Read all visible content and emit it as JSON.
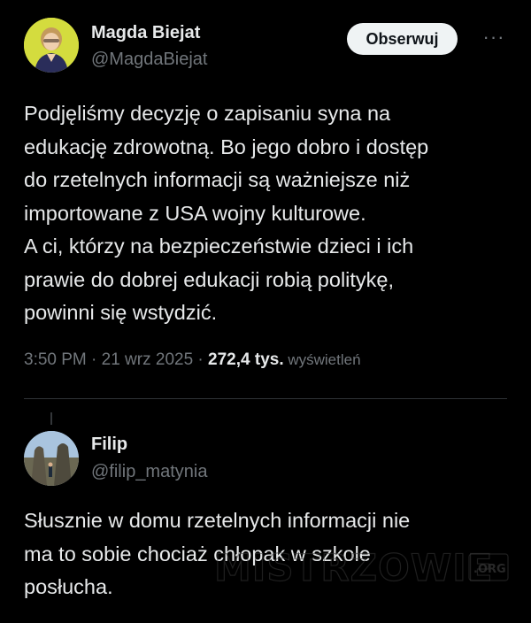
{
  "tweet": {
    "author_name": "Magda Biejat",
    "author_handle": "@MagdaBiejat",
    "follow_label": "Obserwuj",
    "more_label": "···",
    "text": "Podjęliśmy decyzję o zapisaniu syna na\nedukację zdrowotną. Bo jego dobro i dostęp\ndo rzetelnych informacji są ważniejsze niż\nimportowane z USA wojny kulturowe.\nA ci, którzy na bezpieczeństwie dzieci i ich\nprawie do dobrej edukacji robią politykę,\npowinni się wstydzić.",
    "time": "3:50 PM · 21 wrz 2025 · ",
    "views_count": "272,4 tys.",
    "views_label": " wyświetleń"
  },
  "reply": {
    "author_name": "Filip",
    "author_handle": "@filip_matynia",
    "text": "Słusznie w domu rzetelnych informacji nie\nma to sobie chociaż chłopak w szkole\nposłucha."
  },
  "watermark": {
    "text": "MISTRZOWIE",
    "suffix": ".ORG"
  },
  "colors": {
    "background": "#000000",
    "text": "#e7e9ea",
    "secondary": "#71767b",
    "button_bg": "#eff3f4"
  }
}
